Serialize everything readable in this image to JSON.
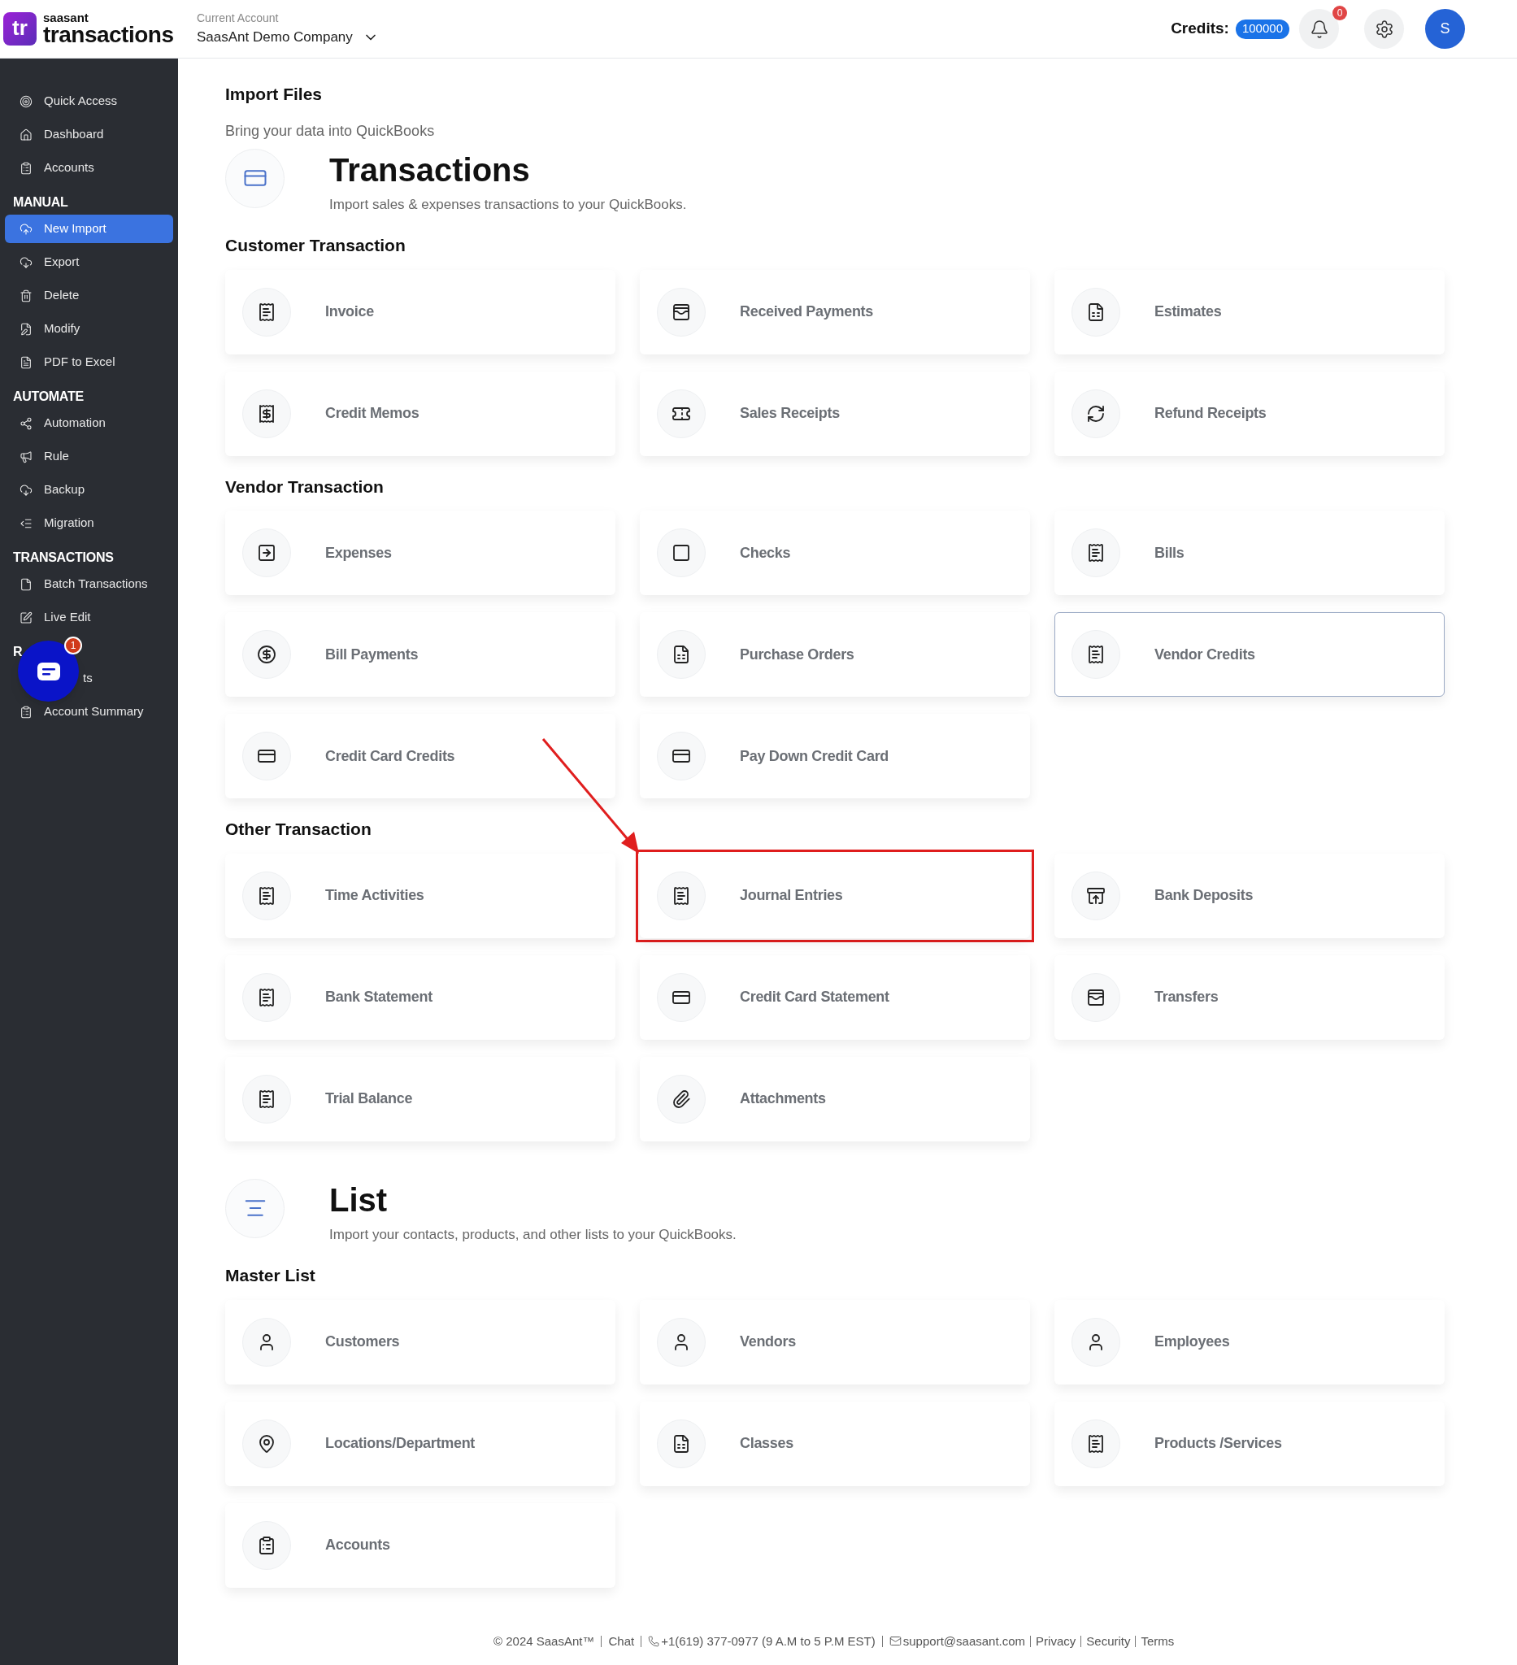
{
  "header": {
    "logo_top": "saasant",
    "logo_bottom": "transactions",
    "logo_mark": "tr",
    "account_label": "Current Account",
    "account_name": "SaasAnt Demo Company",
    "credits_label": "Credits:",
    "credits_value": "100000",
    "notification_count": "0",
    "avatar_letter": "S"
  },
  "sidebar": {
    "groups": [
      {
        "items": [
          {
            "label": "Quick Access",
            "selected": false
          },
          {
            "label": "Dashboard",
            "selected": false
          },
          {
            "label": "Accounts",
            "selected": false
          }
        ]
      },
      {
        "heading": "MANUAL",
        "items": [
          {
            "label": "New Import",
            "selected": true
          },
          {
            "label": "Export",
            "selected": false
          },
          {
            "label": "Delete",
            "selected": false
          },
          {
            "label": "Modify",
            "selected": false
          },
          {
            "label": "PDF to Excel",
            "selected": false
          }
        ]
      },
      {
        "heading": "AUTOMATE",
        "items": [
          {
            "label": "Automation",
            "selected": false
          },
          {
            "label": "Rule",
            "selected": false
          },
          {
            "label": "Backup",
            "selected": false
          },
          {
            "label": "Migration",
            "selected": false
          }
        ]
      },
      {
        "heading": "TRANSACTIONS",
        "items": [
          {
            "label": "Batch Transactions",
            "selected": false
          },
          {
            "label": "Live Edit",
            "selected": false
          }
        ]
      },
      {
        "heading": "R",
        "items": [
          {
            "label": "ts",
            "selected": false
          },
          {
            "label": "Account Summary",
            "selected": false
          }
        ]
      }
    ]
  },
  "chat": {
    "badge": "1"
  },
  "page": {
    "title": "Import Files",
    "subtitle": "Bring your data into QuickBooks"
  },
  "groups": [
    {
      "title": "Transactions",
      "description": "Import sales & expenses transactions to your QuickBooks.",
      "sections": [
        {
          "title": "Customer Transaction",
          "cards": [
            {
              "label": "Invoice",
              "selected": false,
              "highlighted": false
            },
            {
              "label": "Received Payments",
              "selected": false,
              "highlighted": false
            },
            {
              "label": "Estimates",
              "selected": false,
              "highlighted": false
            },
            {
              "label": "Credit Memos",
              "selected": false,
              "highlighted": false
            },
            {
              "label": "Sales Receipts",
              "selected": false,
              "highlighted": false
            },
            {
              "label": "Refund Receipts",
              "selected": false,
              "highlighted": false
            }
          ]
        },
        {
          "title": "Vendor Transaction",
          "cards": [
            {
              "label": "Expenses",
              "selected": false,
              "highlighted": false
            },
            {
              "label": "Checks",
              "selected": false,
              "highlighted": false
            },
            {
              "label": "Bills",
              "selected": false,
              "highlighted": false
            },
            {
              "label": "Bill Payments",
              "selected": false,
              "highlighted": false
            },
            {
              "label": "Purchase Orders",
              "selected": false,
              "highlighted": false
            },
            {
              "label": "Vendor Credits",
              "selected": true,
              "highlighted": false
            },
            {
              "label": "Credit Card Credits",
              "selected": false,
              "highlighted": false
            },
            {
              "label": "Pay Down Credit Card",
              "selected": false,
              "highlighted": false
            }
          ]
        },
        {
          "title": "Other Transaction",
          "cards": [
            {
              "label": "Time Activities",
              "selected": false,
              "highlighted": false
            },
            {
              "label": "Journal Entries",
              "selected": false,
              "highlighted": true
            },
            {
              "label": "Bank Deposits",
              "selected": false,
              "highlighted": false
            },
            {
              "label": "Bank Statement",
              "selected": false,
              "highlighted": false
            },
            {
              "label": "Credit Card Statement",
              "selected": false,
              "highlighted": false
            },
            {
              "label": "Transfers",
              "selected": false,
              "highlighted": false
            },
            {
              "label": "Trial Balance",
              "selected": false,
              "highlighted": false
            },
            {
              "label": "Attachments",
              "selected": false,
              "highlighted": false
            }
          ]
        }
      ]
    },
    {
      "title": "List",
      "description": "Import your contacts, products, and other lists to your QuickBooks.",
      "sections": [
        {
          "title": "Master List",
          "cards": [
            {
              "label": "Customers",
              "selected": false,
              "highlighted": false
            },
            {
              "label": "Vendors",
              "selected": false,
              "highlighted": false
            },
            {
              "label": "Employees",
              "selected": false,
              "highlighted": false
            },
            {
              "label": "Locations/Department",
              "selected": false,
              "highlighted": false
            },
            {
              "label": "Classes",
              "selected": false,
              "highlighted": false
            },
            {
              "label": "Products /Services",
              "selected": false,
              "highlighted": false
            },
            {
              "label": "Accounts",
              "selected": false,
              "highlighted": false
            }
          ]
        }
      ]
    }
  ],
  "footer": {
    "copyright": "© 2024 SaasAnt™",
    "chat": "Chat",
    "phone": "+1(619) 377-0977 (9 A.M to 5 P.M EST)",
    "email": "support@saasant.com",
    "links": [
      "Privacy",
      "Security",
      "Terms"
    ]
  }
}
